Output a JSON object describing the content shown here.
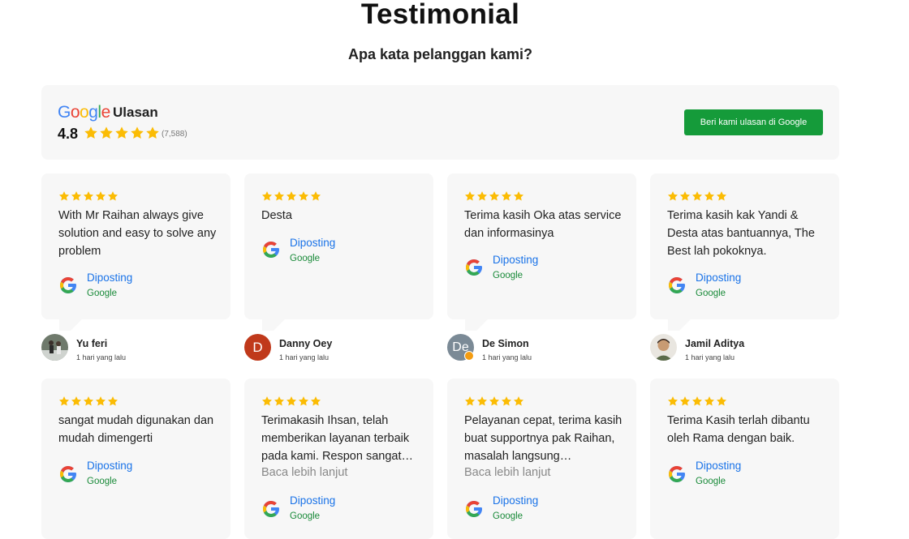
{
  "header": {
    "title": "Testimonial",
    "subtitle": "Apa kata pelanggan kami?"
  },
  "summary": {
    "brand_letters": [
      "G",
      "o",
      "o",
      "g",
      "l",
      "e"
    ],
    "label": "Ulasan",
    "rating": "4.8",
    "stars": 5,
    "count": "(7,588)",
    "button_label": "Beri kami ulasan di Google"
  },
  "reviews": [
    {
      "stars": 5,
      "text": "With Mr Raihan always give solution and easy to solve any problem",
      "read_more": "",
      "posted": "Diposting",
      "source": "Google",
      "author": "Yu feri",
      "time": "1 hari yang lalu",
      "avatar": "photo"
    },
    {
      "stars": 5,
      "text": "Desta",
      "read_more": "",
      "posted": "Diposting",
      "source": "Google",
      "author": "Danny Oey",
      "time": "1 hari yang lalu",
      "avatar": "D"
    },
    {
      "stars": 5,
      "text": "Terima kasih Oka atas service dan informasinya",
      "read_more": "",
      "posted": "Diposting",
      "source": "Google",
      "author": "De Simon",
      "time": "1 hari yang lalu",
      "avatar": "De"
    },
    {
      "stars": 5,
      "text": "Terima kasih kak Yandi & Desta atas bantuannya, The Best lah pokoknya.",
      "read_more": "",
      "posted": "Diposting",
      "source": "Google",
      "author": "Jamil Aditya",
      "time": "1 hari yang lalu",
      "avatar": "photo"
    },
    {
      "stars": 5,
      "text": "sangat mudah digunakan dan mudah dimengerti",
      "read_more": "",
      "posted": "Diposting",
      "source": "Google"
    },
    {
      "stars": 5,
      "text": "Terimakasih Ihsan, telah memberikan layanan terbaik pada kami. Respon sangat…",
      "read_more": "Baca lebih lanjut",
      "posted": "Diposting",
      "source": "Google"
    },
    {
      "stars": 5,
      "text": "Pelayanan cepat, terima kasih buat supportnya pak Raihan, masalah langsung…",
      "read_more": "Baca lebih lanjut",
      "posted": "Diposting",
      "source": "Google"
    },
    {
      "stars": 5,
      "text": "Terima Kasih terlah dibantu oleh Rama dengan baik.",
      "read_more": "",
      "posted": "Diposting",
      "source": "Google"
    }
  ],
  "colors": {
    "star": "#fbbc04",
    "button": "#159b3a",
    "link": "#1a73e8",
    "source": "#198a39",
    "card": "#f7f7f7"
  },
  "icons": [
    "google-g-icon",
    "star-icon"
  ]
}
